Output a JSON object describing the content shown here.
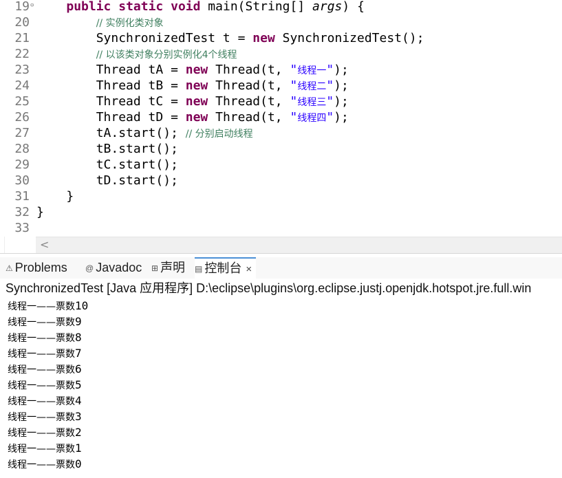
{
  "editor": {
    "line_numbers": [
      "19",
      "20",
      "21",
      "22",
      "23",
      "24",
      "25",
      "26",
      "27",
      "28",
      "29",
      "30",
      "31",
      "32",
      "33"
    ],
    "fold_marker": "⊖",
    "lines": [
      [
        {
          "t": "    "
        },
        {
          "t": "public",
          "c": "kw"
        },
        {
          "t": " "
        },
        {
          "t": "static",
          "c": "kw"
        },
        {
          "t": " "
        },
        {
          "t": "void",
          "c": "kw"
        },
        {
          "t": " main(String[] "
        },
        {
          "t": "args",
          "c": "pi"
        },
        {
          "t": ") {"
        }
      ],
      [
        {
          "t": "        "
        },
        {
          "t": "// 实例化类对象",
          "c": "cm"
        }
      ],
      [
        {
          "t": "        SynchronizedTest t = "
        },
        {
          "t": "new",
          "c": "kw"
        },
        {
          "t": " SynchronizedTest();"
        }
      ],
      [
        {
          "t": "        "
        },
        {
          "t": "// 以该类对象分别实例化4个线程",
          "c": "cm"
        }
      ],
      [
        {
          "t": "        Thread tA = "
        },
        {
          "t": "new",
          "c": "kw"
        },
        {
          "t": " Thread(t, "
        },
        {
          "t": "\"线程一\"",
          "c": "st"
        },
        {
          "t": ");"
        }
      ],
      [
        {
          "t": "        Thread tB = "
        },
        {
          "t": "new",
          "c": "kw"
        },
        {
          "t": " Thread(t, "
        },
        {
          "t": "\"线程二\"",
          "c": "st"
        },
        {
          "t": ");"
        }
      ],
      [
        {
          "t": "        Thread tC = "
        },
        {
          "t": "new",
          "c": "kw"
        },
        {
          "t": " Thread(t, "
        },
        {
          "t": "\"线程三\"",
          "c": "st"
        },
        {
          "t": ");"
        }
      ],
      [
        {
          "t": "        Thread tD = "
        },
        {
          "t": "new",
          "c": "kw"
        },
        {
          "t": " Thread(t, "
        },
        {
          "t": "\"线程四\"",
          "c": "st"
        },
        {
          "t": ");"
        }
      ],
      [
        {
          "t": "        tA.start(); "
        },
        {
          "t": "// 分别启动线程",
          "c": "cm"
        }
      ],
      [
        {
          "t": "        tB.start();"
        }
      ],
      [
        {
          "t": "        tC.start();"
        }
      ],
      [
        {
          "t": "        tD.start();"
        }
      ],
      [
        {
          "t": "    }"
        }
      ],
      [
        {
          "t": "}"
        }
      ],
      [
        {
          "t": ""
        }
      ]
    ],
    "scroll_left_glyph": "<"
  },
  "tabs": [
    {
      "icon": "problems-icon",
      "glyph": "⚠",
      "label": "Problems"
    },
    {
      "icon": "javadoc-icon",
      "glyph": "@",
      "label": "Javadoc"
    },
    {
      "icon": "declaration-icon",
      "glyph": "⊞",
      "label": "声明"
    },
    {
      "icon": "console-icon",
      "glyph": "▤",
      "label": "控制台",
      "close": "×"
    }
  ],
  "console": {
    "header": "SynchronizedTest [Java 应用程序] D:\\eclipse\\plugins\\org.eclipse.justj.openjdk.hotspot.jre.full.win",
    "output": [
      "线程一——票数10",
      "线程一——票数9",
      "线程一——票数8",
      "线程一——票数7",
      "线程一——票数6",
      "线程一——票数5",
      "线程一——票数4",
      "线程一——票数3",
      "线程一——票数2",
      "线程一——票数1",
      "线程一——票数0"
    ]
  },
  "colors": {
    "keyword": "#7f0055",
    "comment": "#3f7f5f",
    "string": "#2a00ff",
    "line_number": "#787878",
    "active_tab_border": "#4a8fd6"
  }
}
